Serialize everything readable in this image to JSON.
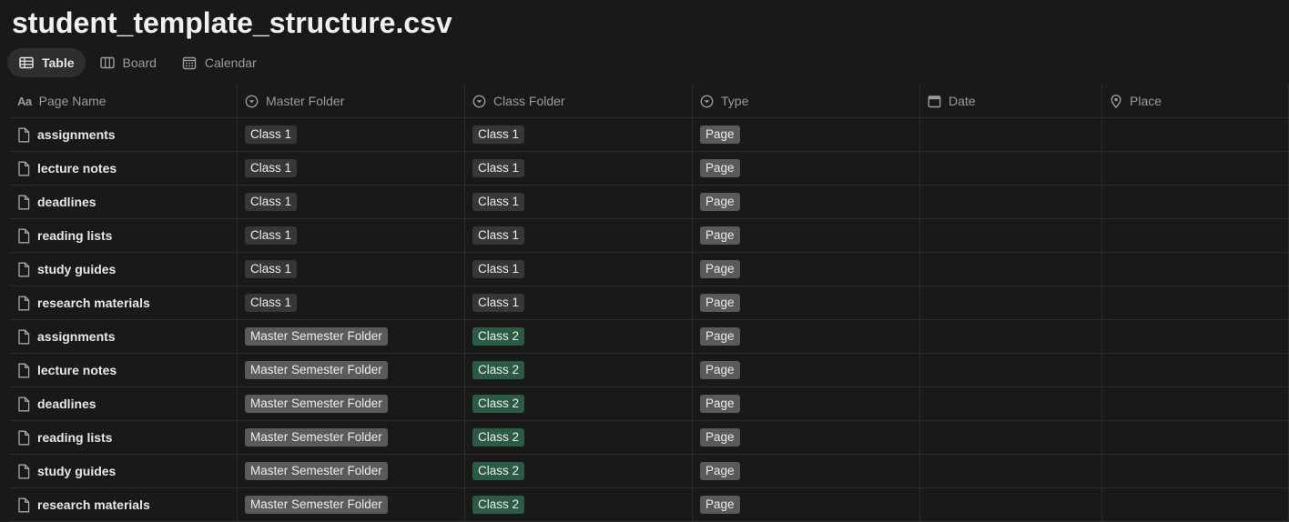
{
  "title": "student_template_structure.csv",
  "views": [
    {
      "label": "Table",
      "icon": "table-icon",
      "active": true
    },
    {
      "label": "Board",
      "icon": "board-icon",
      "active": false
    },
    {
      "label": "Calendar",
      "icon": "calendar-icon",
      "active": false
    }
  ],
  "columns": [
    {
      "label": "Page Name",
      "icon": "text-property-icon"
    },
    {
      "label": "Master Folder",
      "icon": "select-property-icon"
    },
    {
      "label": "Class Folder",
      "icon": "select-property-icon"
    },
    {
      "label": "Type",
      "icon": "select-property-icon"
    },
    {
      "label": "Date",
      "icon": "date-property-icon"
    },
    {
      "label": "Place",
      "icon": "place-property-icon"
    }
  ],
  "rows": [
    {
      "name": "assignments",
      "master": "Class 1",
      "cls": "Class 1",
      "type": "Page"
    },
    {
      "name": "lecture notes",
      "master": "Class 1",
      "cls": "Class 1",
      "type": "Page"
    },
    {
      "name": "deadlines",
      "master": "Class 1",
      "cls": "Class 1",
      "type": "Page"
    },
    {
      "name": "reading lists",
      "master": "Class 1",
      "cls": "Class 1",
      "type": "Page"
    },
    {
      "name": "study guides",
      "master": "Class 1",
      "cls": "Class 1",
      "type": "Page"
    },
    {
      "name": "research materials",
      "master": "Class 1",
      "cls": "Class 1",
      "type": "Page"
    },
    {
      "name": "assignments",
      "master": "Master Semester Folder",
      "cls": "Class 2",
      "type": "Page"
    },
    {
      "name": "lecture notes",
      "master": "Master Semester Folder",
      "cls": "Class 2",
      "type": "Page"
    },
    {
      "name": "deadlines",
      "master": "Master Semester Folder",
      "cls": "Class 2",
      "type": "Page"
    },
    {
      "name": "reading lists",
      "master": "Master Semester Folder",
      "cls": "Class 2",
      "type": "Page"
    },
    {
      "name": "study guides",
      "master": "Master Semester Folder",
      "cls": "Class 2",
      "type": "Page"
    },
    {
      "name": "research materials",
      "master": "Master Semester Folder",
      "cls": "Class 2",
      "type": "Page"
    }
  ],
  "tag_colors": {
    "Class 1": "#373737",
    "Class 2": "#2b5b44",
    "Master Semester Folder": "#5a5a5a",
    "Page": "#5a5a5a"
  }
}
